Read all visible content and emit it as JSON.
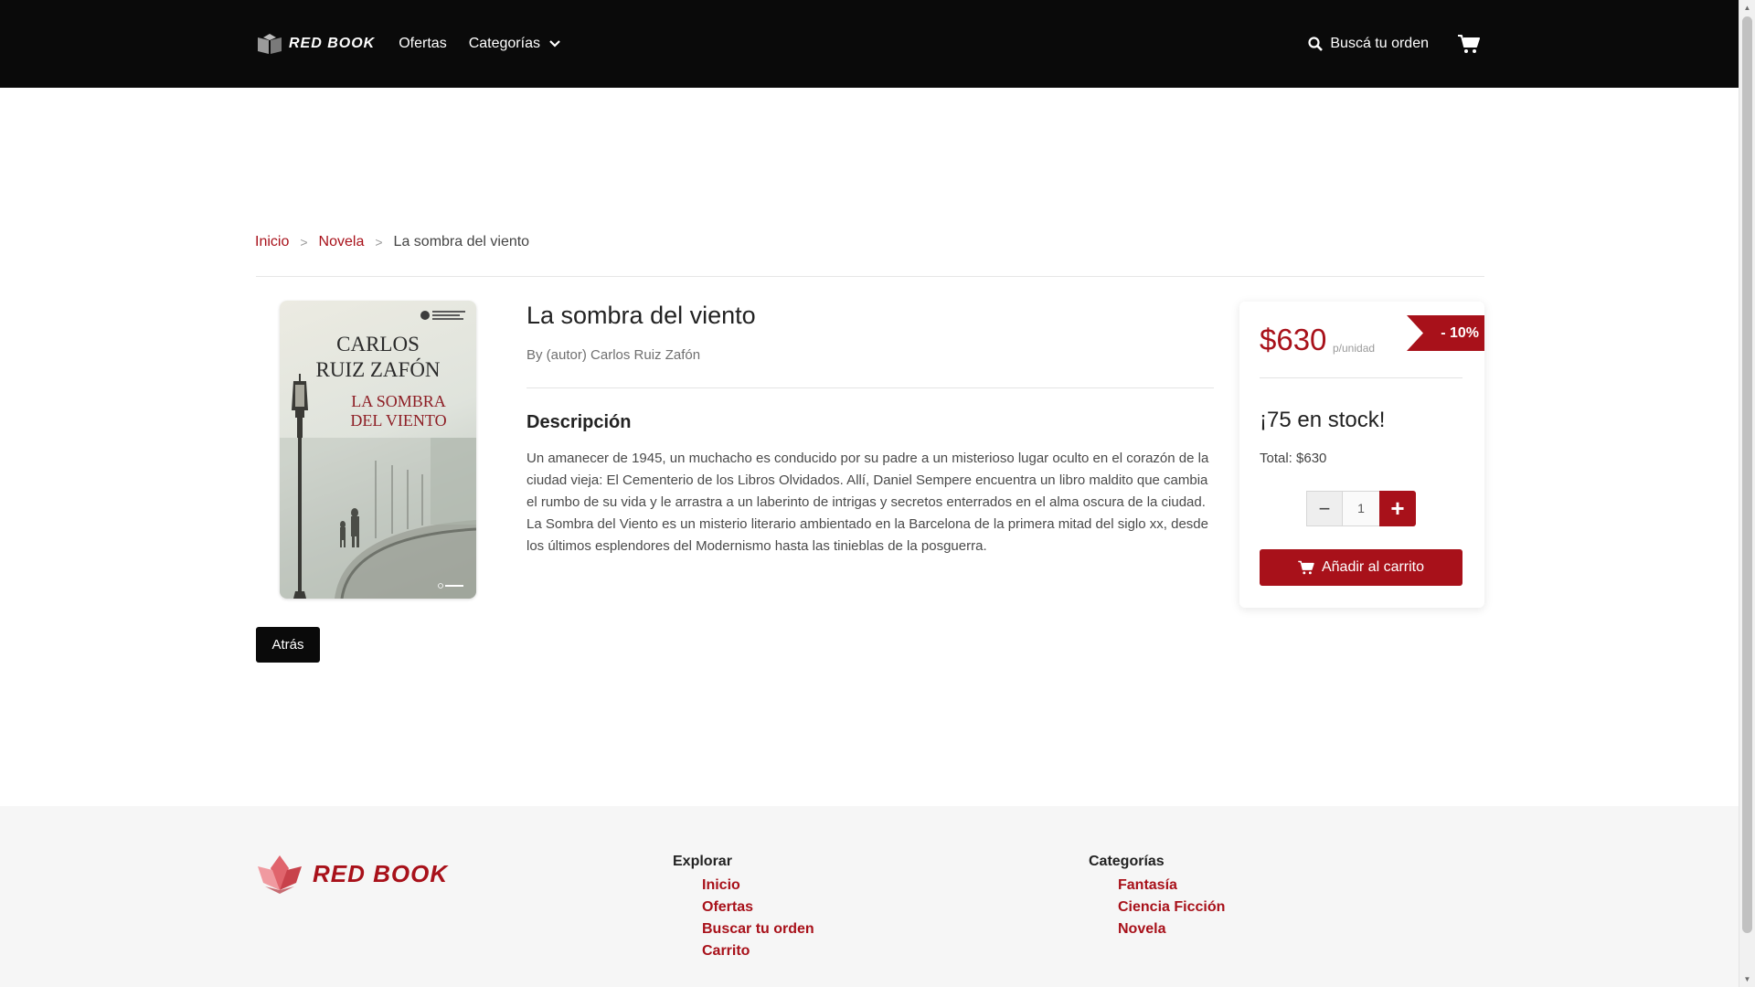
{
  "header": {
    "logo_text": "RED BOOK",
    "nav": {
      "offers": "Ofertas",
      "categories": "Categorías"
    },
    "search_order": "Buscá tu orden"
  },
  "breadcrumb": {
    "home": "Inicio",
    "category": "Novela",
    "current": "La sombra del viento"
  },
  "product": {
    "cover": {
      "author_line1": "CARLOS",
      "author_line2": "RUIZ ZAFÓN",
      "title_line1": "LA SOMBRA",
      "title_line2": "DEL VIENTO"
    },
    "title": "La sombra del viento",
    "author": "By (autor) Carlos Ruiz Zafón",
    "description_title": "Descripción",
    "description": "Un amanecer de 1945, un muchacho es conducido por su padre a un misterioso lugar oculto en el corazón de la ciudad vieja: El Cementerio de los Libros Olvidados. Allí, Daniel Sempere encuentra un libro maldito que cambia el rumbo de su vida y le arrastra a un laberinto de intrigas y secretos enterrados en el alma oscura de la ciudad. La Sombra del Viento es un misterio literario ambientado en la Barcelona de la primera mitad del siglo xx, desde los últimos esplendores del Modernismo hasta las tinieblas de la posguerra."
  },
  "buy_box": {
    "price": "$630",
    "per_unit": "p/unidad",
    "discount": "- 10%",
    "stock": "¡75 en stock!",
    "total": "Total: $630",
    "quantity": "1",
    "minus": "−",
    "plus": "+",
    "add_to_cart": "Añadir al carrito"
  },
  "back_button": "Atrás",
  "footer": {
    "logo_text": "RED BOOK",
    "explore_title": "Explorar",
    "explore_links": [
      "Inicio",
      "Ofertas",
      "Buscar tu orden",
      "Carrito"
    ],
    "categories_title": "Categorías",
    "category_links": [
      "Fantasía",
      "Ciencia Ficción",
      "Novela"
    ]
  },
  "colors": {
    "accent": "#a8111a",
    "header_bg": "#0a0a0a",
    "footer_bg": "#f6f6f6"
  }
}
